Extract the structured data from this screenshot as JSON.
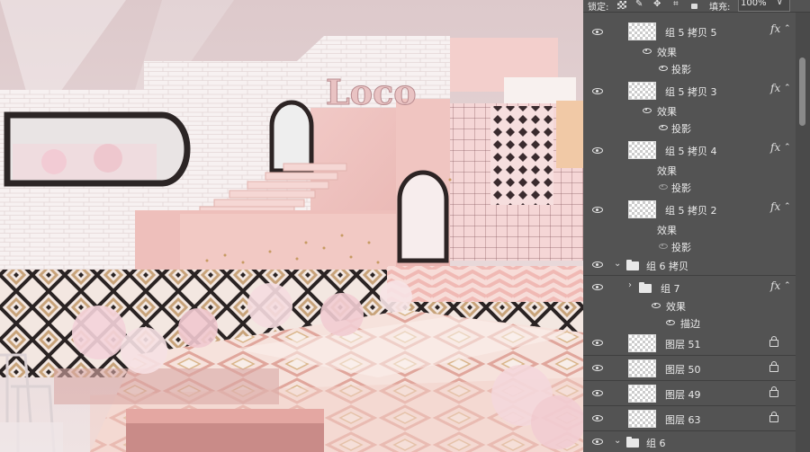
{
  "canvas": {
    "logo_text": "Loco"
  },
  "panel": {
    "toolbar": {
      "lock_label": "锁定:",
      "fill_label": "填充:",
      "fill_value": "100%",
      "dropdown_arrow": "∨"
    },
    "layers": [
      {
        "name": "组 5 拷贝 5",
        "fx": "fx",
        "effects_label": "效果",
        "effect": "投影"
      },
      {
        "name": "组 5 拷贝 3",
        "fx": "fx",
        "effects_label": "效果",
        "effect": "投影"
      },
      {
        "name": "组 5 拷贝 4",
        "fx": "fx",
        "effects_label": "效果",
        "effect": "投影"
      },
      {
        "name": "组 5 拷贝 2",
        "fx": "fx",
        "effects_label": "效果",
        "effect": "投影"
      }
    ],
    "group6copy": {
      "name": "组 6 拷贝"
    },
    "group7": {
      "name": "组 7",
      "fx": "fx",
      "effects_label": "效果",
      "effect": "描边"
    },
    "plain_layers": [
      {
        "name": "图层 51"
      },
      {
        "name": "图层 50"
      },
      {
        "name": "图层 49"
      },
      {
        "name": "图层 63"
      }
    ],
    "group6": {
      "name": "组 6"
    }
  }
}
